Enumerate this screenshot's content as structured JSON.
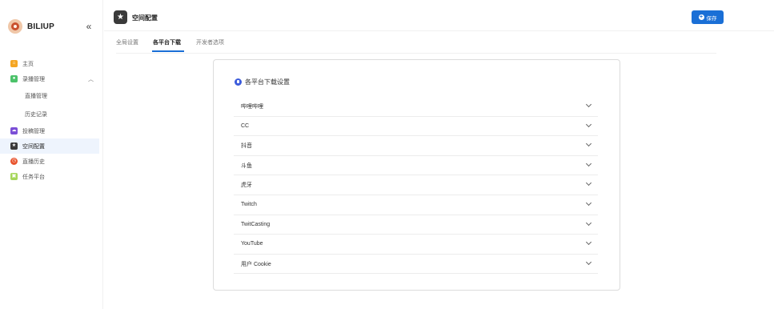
{
  "brand": {
    "name": "BILIUP",
    "collapse_glyph": "«"
  },
  "sidebar": {
    "items": [
      {
        "label": "主页",
        "color": "#f5a623"
      },
      {
        "label": "录播管理",
        "color": "#4cc26a"
      },
      {
        "label": "直播管理"
      },
      {
        "label": "历史记录"
      },
      {
        "label": "投稿管理",
        "color": "#7b4fd6"
      },
      {
        "label": "空间配置",
        "color": "#3a3a3a"
      },
      {
        "label": "直播历史",
        "color": "#e8542e"
      },
      {
        "label": "任务平台",
        "color": "#a6d65a"
      }
    ]
  },
  "header": {
    "title": "空间配置",
    "save_label": "保存"
  },
  "tabs": [
    {
      "label": "全局设置"
    },
    {
      "label": "各平台下载"
    },
    {
      "label": "开发者选项"
    }
  ],
  "card": {
    "title": "各平台下载设置",
    "rows": [
      {
        "label": "哔哩哔哩"
      },
      {
        "label": "CC"
      },
      {
        "label": "抖音"
      },
      {
        "label": "斗鱼"
      },
      {
        "label": "虎牙"
      },
      {
        "label": "Twitch"
      },
      {
        "label": "TwitCasting"
      },
      {
        "label": "YouTube"
      },
      {
        "label": "用户 Cookie"
      }
    ]
  }
}
